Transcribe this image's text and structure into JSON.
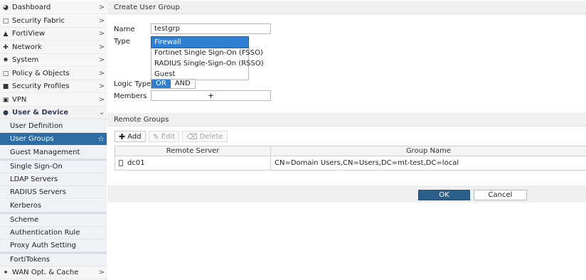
{
  "sidebar": {
    "top_items": [
      {
        "label": "Dashboard",
        "icon": "dashboard-icon"
      },
      {
        "label": "Security Fabric",
        "icon": "shield-outline-icon"
      },
      {
        "label": "FortiView",
        "icon": "chart-icon"
      },
      {
        "label": "Network",
        "icon": "network-icon"
      },
      {
        "label": "System",
        "icon": "gear-icon"
      },
      {
        "label": "Policy & Objects",
        "icon": "document-icon"
      },
      {
        "label": "Security Profiles",
        "icon": "lock-icon"
      },
      {
        "label": "VPN",
        "icon": "monitor-icon"
      }
    ],
    "section": {
      "label": "User & Device",
      "icon": "user-icon"
    },
    "sub_items": [
      {
        "label": "User Definition"
      },
      {
        "label": "User Groups"
      },
      {
        "label": "Guest Management"
      },
      {
        "label": "Single Sign-On"
      },
      {
        "label": "LDAP Servers"
      },
      {
        "label": "RADIUS Servers"
      },
      {
        "label": "Kerberos"
      },
      {
        "label": "Scheme"
      },
      {
        "label": "Authentication Rule"
      },
      {
        "label": "Proxy Auth Setting"
      },
      {
        "label": "FortiTokens"
      }
    ],
    "bottom_item": {
      "label": "WAN Opt. & Cache",
      "icon": "bolt-icon"
    }
  },
  "form": {
    "header": "Create User Group",
    "name_label": "Name",
    "name_value": "testgrp",
    "type_label": "Type",
    "type_options": [
      "Firewall",
      "Fortinet Single Sign-On (FSSO)",
      "RADIUS Single-Sign-On (RSSO)",
      "Guest"
    ],
    "type_selected": "Firewall",
    "logic_label": "Logic Type",
    "logic_options": [
      "OR",
      "AND"
    ],
    "logic_selected": "OR",
    "members_label": "Members",
    "members_add": "+"
  },
  "remote_groups": {
    "header": "Remote Groups",
    "toolbar": {
      "add": "Add",
      "edit": "Edit",
      "delete": "Delete"
    },
    "columns": [
      "Remote Server",
      "Group Name"
    ],
    "rows": [
      {
        "server": "dc01",
        "group": "CN=Domain Users,CN=Users,DC=mt-test,DC=local"
      }
    ]
  },
  "actions": {
    "ok": "OK",
    "cancel": "Cancel"
  },
  "colors": {
    "accent": "#2e7fd3",
    "active_nav": "#2e6ca4",
    "ok_button": "#2c5f8c"
  }
}
